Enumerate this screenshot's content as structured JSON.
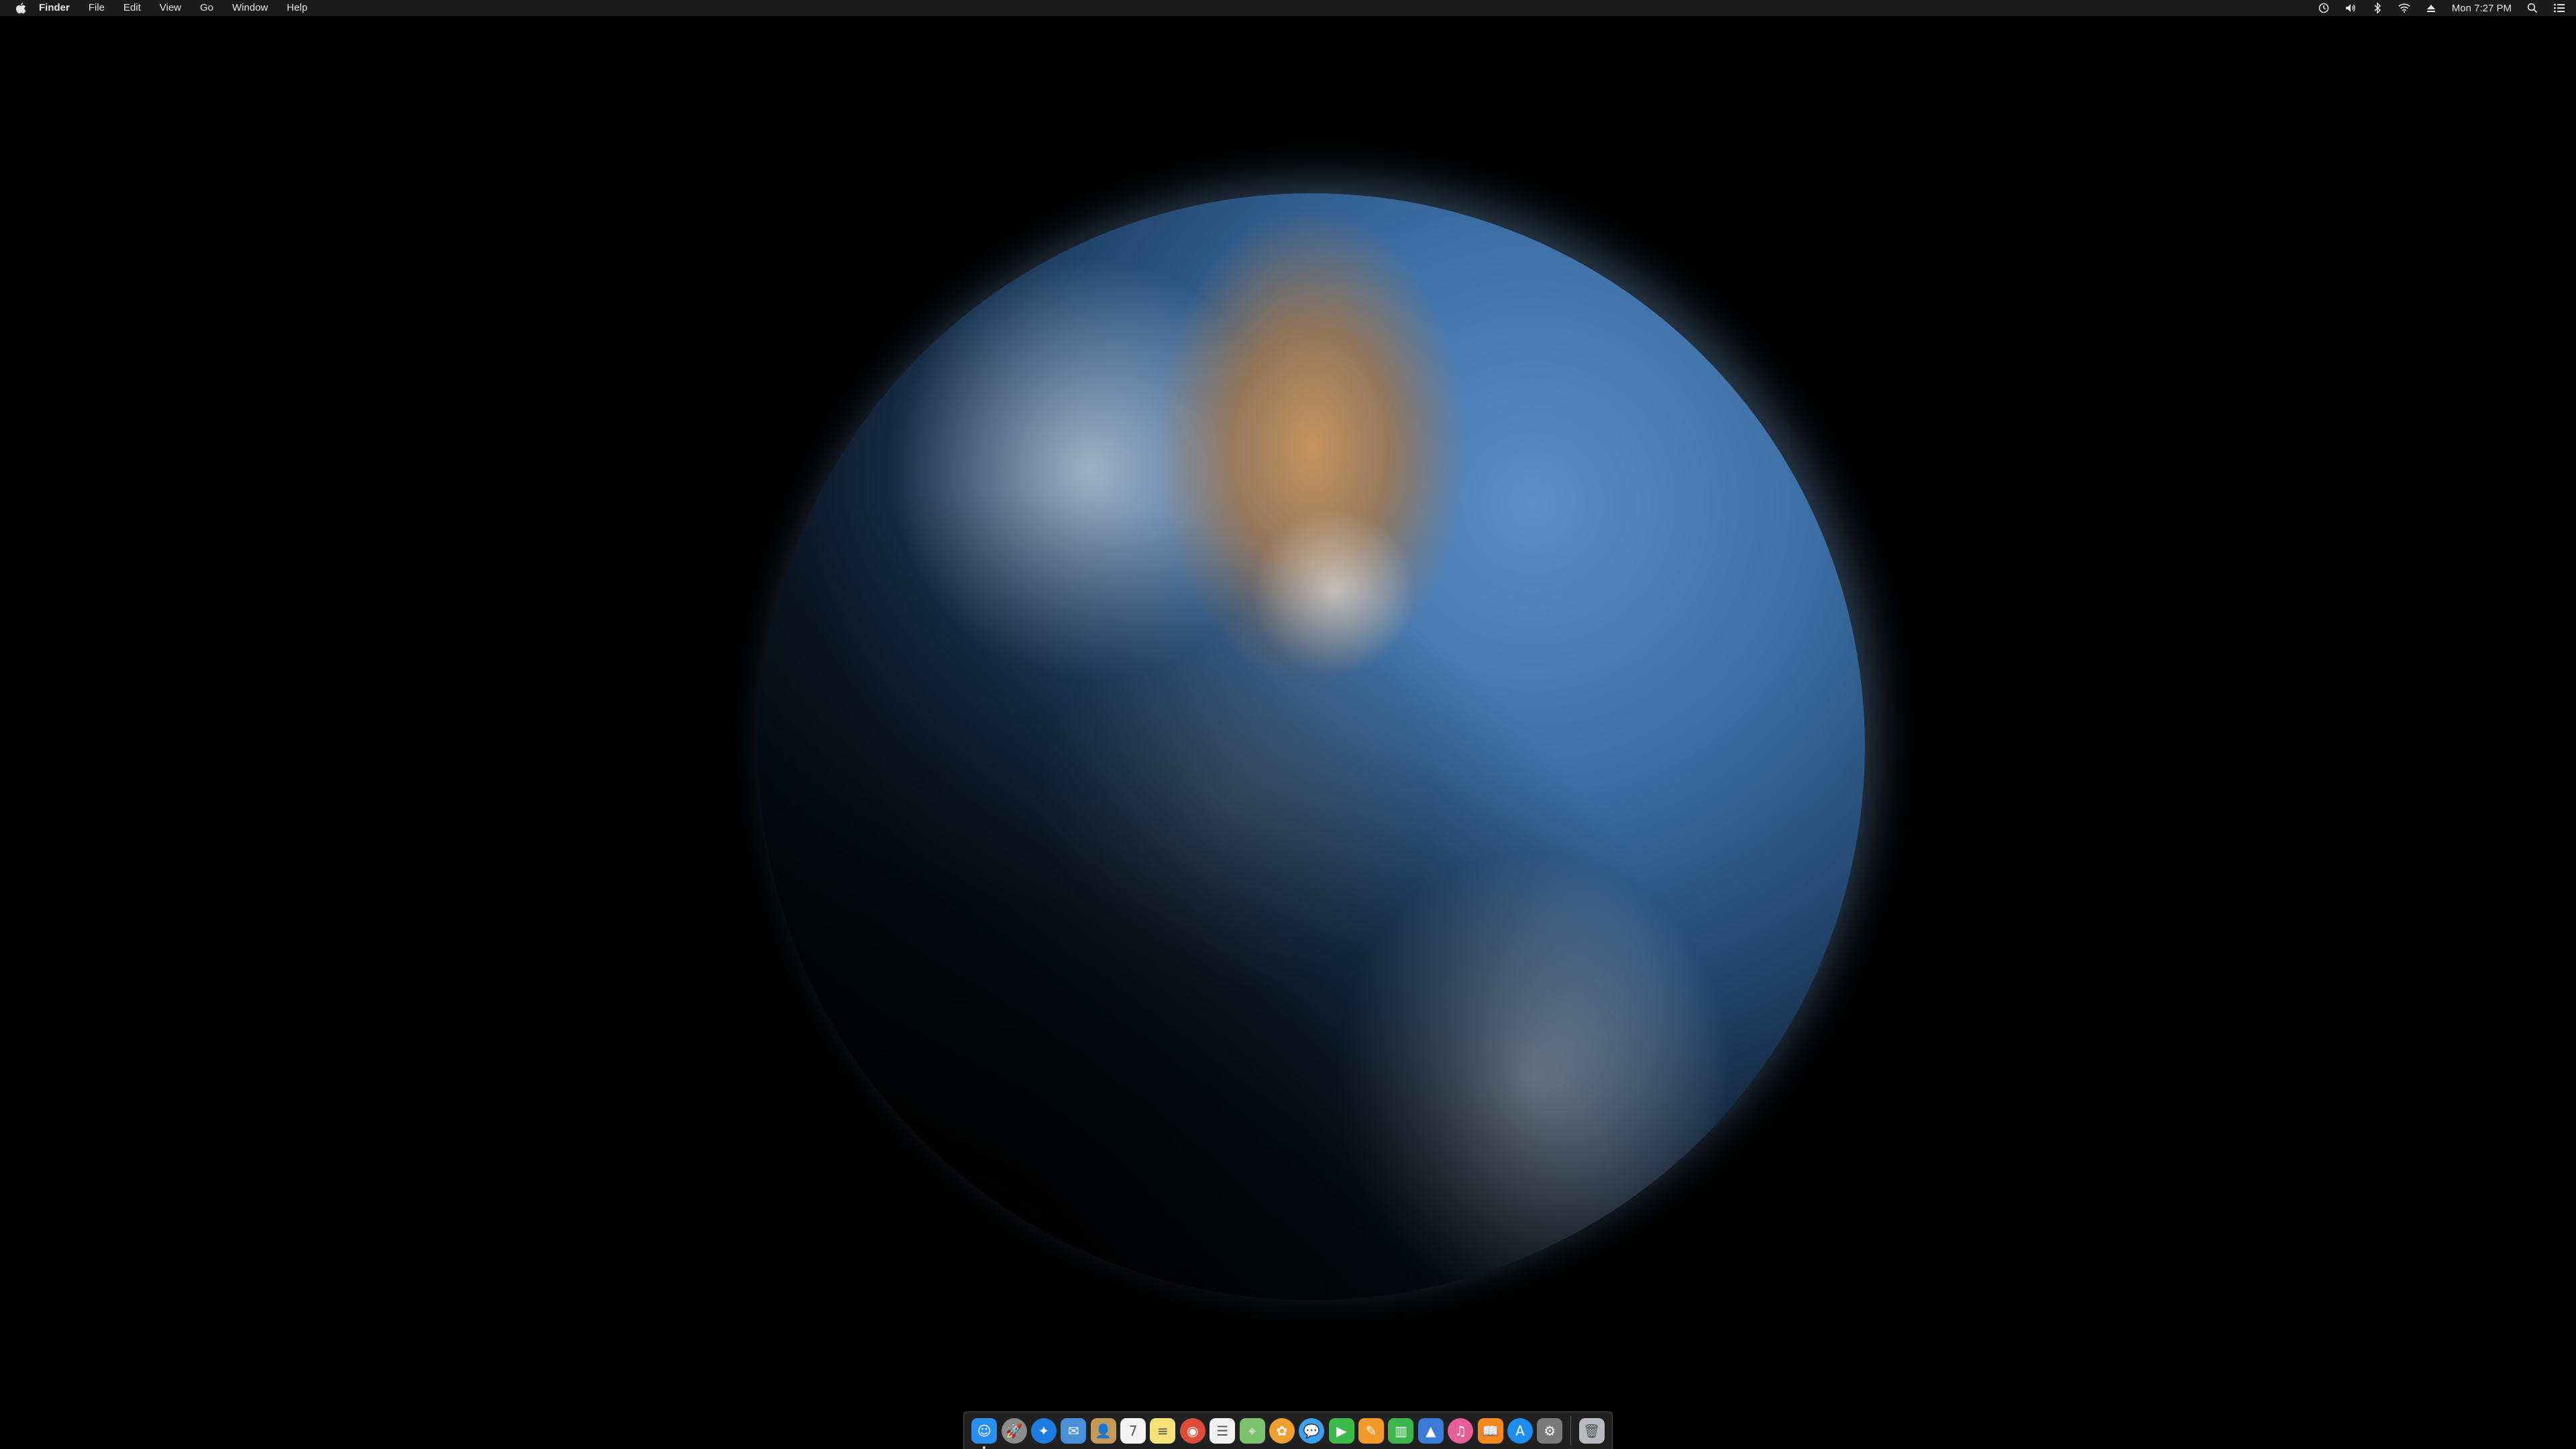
{
  "menubar": {
    "apple_icon": "apple-icon",
    "items": [
      "Finder",
      "File",
      "Edit",
      "View",
      "Go",
      "Window",
      "Help"
    ],
    "status_icons": [
      "time-machine-icon",
      "volume-icon",
      "bluetooth-icon",
      "wifi-icon",
      "eject-icon"
    ],
    "clock": "Mon 7:27 PM",
    "right_icons": [
      "spotlight-icon",
      "notification-center-icon"
    ]
  },
  "wallpaper": {
    "subject": "earth-globe"
  },
  "dock": {
    "apps": [
      {
        "name": "finder",
        "icon": "finder-icon",
        "color": "#2b8ff0",
        "glyph": "☺",
        "running": true
      },
      {
        "name": "launchpad",
        "icon": "launchpad-icon",
        "color": "#8c8c8c",
        "glyph": "🚀",
        "running": false
      },
      {
        "name": "safari",
        "icon": "safari-icon",
        "color": "#1e7be0",
        "glyph": "✦",
        "running": false
      },
      {
        "name": "mail",
        "icon": "mail-icon",
        "color": "#4a90d9",
        "glyph": "✉",
        "running": false
      },
      {
        "name": "contacts",
        "icon": "contacts-icon",
        "color": "#c49a5a",
        "glyph": "👤",
        "running": false
      },
      {
        "name": "calendar",
        "icon": "calendar-icon",
        "color": "#f4f4f4",
        "glyph": "7",
        "running": false
      },
      {
        "name": "notes",
        "icon": "notes-icon",
        "color": "#f7e27a",
        "glyph": "≡",
        "running": false
      },
      {
        "name": "chrome",
        "icon": "chrome-icon",
        "color": "#dd4b39",
        "glyph": "◉",
        "running": false
      },
      {
        "name": "reminders",
        "icon": "reminders-icon",
        "color": "#f2f2f2",
        "glyph": "☰",
        "running": false
      },
      {
        "name": "maps",
        "icon": "maps-icon",
        "color": "#7cc16b",
        "glyph": "⌖",
        "running": false
      },
      {
        "name": "photos",
        "icon": "photos-icon",
        "color": "#f0a030",
        "glyph": "✿",
        "running": false
      },
      {
        "name": "messages",
        "icon": "messages-icon",
        "color": "#3aa0f0",
        "glyph": "💬",
        "running": false
      },
      {
        "name": "facetime",
        "icon": "facetime-icon",
        "color": "#3dbb4a",
        "glyph": "▶",
        "running": false
      },
      {
        "name": "pages",
        "icon": "pages-icon",
        "color": "#f19a2a",
        "glyph": "✎",
        "running": false
      },
      {
        "name": "numbers",
        "icon": "numbers-icon",
        "color": "#3eb54a",
        "glyph": "▥",
        "running": false
      },
      {
        "name": "keynote",
        "icon": "keynote-icon",
        "color": "#3a7bd5",
        "glyph": "▲",
        "running": false
      },
      {
        "name": "itunes",
        "icon": "itunes-icon",
        "color": "#e85d9a",
        "glyph": "♫",
        "running": false
      },
      {
        "name": "ibooks",
        "icon": "ibooks-icon",
        "color": "#f28a1e",
        "glyph": "📖",
        "running": false
      },
      {
        "name": "app-store",
        "icon": "app-store-icon",
        "color": "#1d8ef0",
        "glyph": "A",
        "running": false
      },
      {
        "name": "system-preferences",
        "icon": "system-preferences-icon",
        "color": "#7a7a7a",
        "glyph": "⚙",
        "running": false
      }
    ],
    "trash": {
      "name": "trash",
      "icon": "trash-icon",
      "color": "#b8bcc0",
      "glyph": "🗑"
    }
  }
}
